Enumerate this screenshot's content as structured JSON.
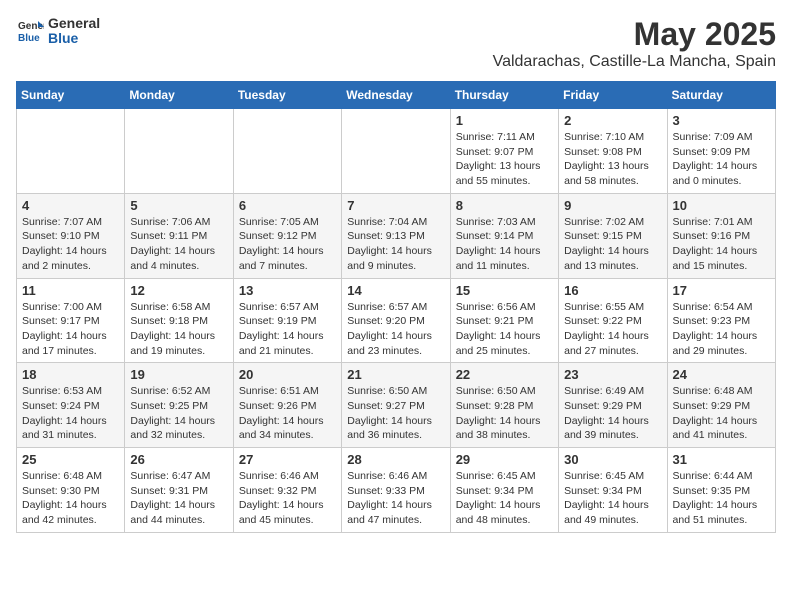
{
  "logo": {
    "general": "General",
    "blue": "Blue"
  },
  "title": "May 2025",
  "subtitle": "Valdarachas, Castille-La Mancha, Spain",
  "weekdays": [
    "Sunday",
    "Monday",
    "Tuesday",
    "Wednesday",
    "Thursday",
    "Friday",
    "Saturday"
  ],
  "weeks": [
    [
      {
        "day": "",
        "sunrise": "",
        "sunset": "",
        "daylight": ""
      },
      {
        "day": "",
        "sunrise": "",
        "sunset": "",
        "daylight": ""
      },
      {
        "day": "",
        "sunrise": "",
        "sunset": "",
        "daylight": ""
      },
      {
        "day": "",
        "sunrise": "",
        "sunset": "",
        "daylight": ""
      },
      {
        "day": "1",
        "sunrise": "Sunrise: 7:11 AM",
        "sunset": "Sunset: 9:07 PM",
        "daylight": "Daylight: 13 hours and 55 minutes."
      },
      {
        "day": "2",
        "sunrise": "Sunrise: 7:10 AM",
        "sunset": "Sunset: 9:08 PM",
        "daylight": "Daylight: 13 hours and 58 minutes."
      },
      {
        "day": "3",
        "sunrise": "Sunrise: 7:09 AM",
        "sunset": "Sunset: 9:09 PM",
        "daylight": "Daylight: 14 hours and 0 minutes."
      }
    ],
    [
      {
        "day": "4",
        "sunrise": "Sunrise: 7:07 AM",
        "sunset": "Sunset: 9:10 PM",
        "daylight": "Daylight: 14 hours and 2 minutes."
      },
      {
        "day": "5",
        "sunrise": "Sunrise: 7:06 AM",
        "sunset": "Sunset: 9:11 PM",
        "daylight": "Daylight: 14 hours and 4 minutes."
      },
      {
        "day": "6",
        "sunrise": "Sunrise: 7:05 AM",
        "sunset": "Sunset: 9:12 PM",
        "daylight": "Daylight: 14 hours and 7 minutes."
      },
      {
        "day": "7",
        "sunrise": "Sunrise: 7:04 AM",
        "sunset": "Sunset: 9:13 PM",
        "daylight": "Daylight: 14 hours and 9 minutes."
      },
      {
        "day": "8",
        "sunrise": "Sunrise: 7:03 AM",
        "sunset": "Sunset: 9:14 PM",
        "daylight": "Daylight: 14 hours and 11 minutes."
      },
      {
        "day": "9",
        "sunrise": "Sunrise: 7:02 AM",
        "sunset": "Sunset: 9:15 PM",
        "daylight": "Daylight: 14 hours and 13 minutes."
      },
      {
        "day": "10",
        "sunrise": "Sunrise: 7:01 AM",
        "sunset": "Sunset: 9:16 PM",
        "daylight": "Daylight: 14 hours and 15 minutes."
      }
    ],
    [
      {
        "day": "11",
        "sunrise": "Sunrise: 7:00 AM",
        "sunset": "Sunset: 9:17 PM",
        "daylight": "Daylight: 14 hours and 17 minutes."
      },
      {
        "day": "12",
        "sunrise": "Sunrise: 6:58 AM",
        "sunset": "Sunset: 9:18 PM",
        "daylight": "Daylight: 14 hours and 19 minutes."
      },
      {
        "day": "13",
        "sunrise": "Sunrise: 6:57 AM",
        "sunset": "Sunset: 9:19 PM",
        "daylight": "Daylight: 14 hours and 21 minutes."
      },
      {
        "day": "14",
        "sunrise": "Sunrise: 6:57 AM",
        "sunset": "Sunset: 9:20 PM",
        "daylight": "Daylight: 14 hours and 23 minutes."
      },
      {
        "day": "15",
        "sunrise": "Sunrise: 6:56 AM",
        "sunset": "Sunset: 9:21 PM",
        "daylight": "Daylight: 14 hours and 25 minutes."
      },
      {
        "day": "16",
        "sunrise": "Sunrise: 6:55 AM",
        "sunset": "Sunset: 9:22 PM",
        "daylight": "Daylight: 14 hours and 27 minutes."
      },
      {
        "day": "17",
        "sunrise": "Sunrise: 6:54 AM",
        "sunset": "Sunset: 9:23 PM",
        "daylight": "Daylight: 14 hours and 29 minutes."
      }
    ],
    [
      {
        "day": "18",
        "sunrise": "Sunrise: 6:53 AM",
        "sunset": "Sunset: 9:24 PM",
        "daylight": "Daylight: 14 hours and 31 minutes."
      },
      {
        "day": "19",
        "sunrise": "Sunrise: 6:52 AM",
        "sunset": "Sunset: 9:25 PM",
        "daylight": "Daylight: 14 hours and 32 minutes."
      },
      {
        "day": "20",
        "sunrise": "Sunrise: 6:51 AM",
        "sunset": "Sunset: 9:26 PM",
        "daylight": "Daylight: 14 hours and 34 minutes."
      },
      {
        "day": "21",
        "sunrise": "Sunrise: 6:50 AM",
        "sunset": "Sunset: 9:27 PM",
        "daylight": "Daylight: 14 hours and 36 minutes."
      },
      {
        "day": "22",
        "sunrise": "Sunrise: 6:50 AM",
        "sunset": "Sunset: 9:28 PM",
        "daylight": "Daylight: 14 hours and 38 minutes."
      },
      {
        "day": "23",
        "sunrise": "Sunrise: 6:49 AM",
        "sunset": "Sunset: 9:29 PM",
        "daylight": "Daylight: 14 hours and 39 minutes."
      },
      {
        "day": "24",
        "sunrise": "Sunrise: 6:48 AM",
        "sunset": "Sunset: 9:29 PM",
        "daylight": "Daylight: 14 hours and 41 minutes."
      }
    ],
    [
      {
        "day": "25",
        "sunrise": "Sunrise: 6:48 AM",
        "sunset": "Sunset: 9:30 PM",
        "daylight": "Daylight: 14 hours and 42 minutes."
      },
      {
        "day": "26",
        "sunrise": "Sunrise: 6:47 AM",
        "sunset": "Sunset: 9:31 PM",
        "daylight": "Daylight: 14 hours and 44 minutes."
      },
      {
        "day": "27",
        "sunrise": "Sunrise: 6:46 AM",
        "sunset": "Sunset: 9:32 PM",
        "daylight": "Daylight: 14 hours and 45 minutes."
      },
      {
        "day": "28",
        "sunrise": "Sunrise: 6:46 AM",
        "sunset": "Sunset: 9:33 PM",
        "daylight": "Daylight: 14 hours and 47 minutes."
      },
      {
        "day": "29",
        "sunrise": "Sunrise: 6:45 AM",
        "sunset": "Sunset: 9:34 PM",
        "daylight": "Daylight: 14 hours and 48 minutes."
      },
      {
        "day": "30",
        "sunrise": "Sunrise: 6:45 AM",
        "sunset": "Sunset: 9:34 PM",
        "daylight": "Daylight: 14 hours and 49 minutes."
      },
      {
        "day": "31",
        "sunrise": "Sunrise: 6:44 AM",
        "sunset": "Sunset: 9:35 PM",
        "daylight": "Daylight: 14 hours and 51 minutes."
      }
    ]
  ]
}
